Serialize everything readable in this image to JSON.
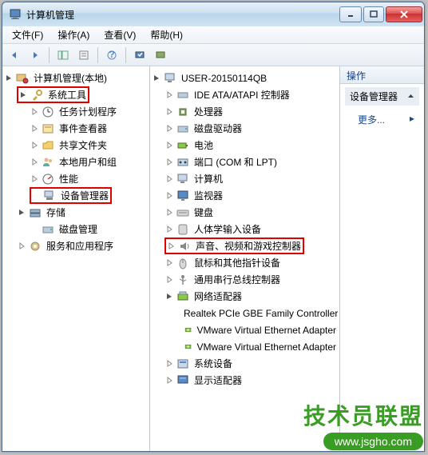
{
  "window": {
    "title": "计算机管理"
  },
  "menubar": [
    {
      "label": "文件(F)"
    },
    {
      "label": "操作(A)"
    },
    {
      "label": "查看(V)"
    },
    {
      "label": "帮助(H)"
    }
  ],
  "left_tree": {
    "root": {
      "label": "计算机管理(本地)"
    },
    "system_tools": {
      "label": "系统工具",
      "children": [
        {
          "label": "任务计划程序"
        },
        {
          "label": "事件查看器"
        },
        {
          "label": "共享文件夹"
        },
        {
          "label": "本地用户和组"
        },
        {
          "label": "性能"
        },
        {
          "label": "设备管理器"
        }
      ]
    },
    "storage": {
      "label": "存储",
      "children": [
        {
          "label": "磁盘管理"
        }
      ]
    },
    "services": {
      "label": "服务和应用程序"
    }
  },
  "mid_tree": {
    "root": {
      "label": "USER-20150114QB"
    },
    "items": [
      {
        "label": "IDE ATA/ATAPI 控制器",
        "expandable": true
      },
      {
        "label": "处理器",
        "expandable": true
      },
      {
        "label": "磁盘驱动器",
        "expandable": true
      },
      {
        "label": "电池",
        "expandable": true
      },
      {
        "label": "端口 (COM 和 LPT)",
        "expandable": true
      },
      {
        "label": "计算机",
        "expandable": true
      },
      {
        "label": "监视器",
        "expandable": true
      },
      {
        "label": "键盘",
        "expandable": true
      },
      {
        "label": "人体学输入设备",
        "expandable": true
      },
      {
        "label": "声音、视频和游戏控制器",
        "expandable": true,
        "highlight": true
      },
      {
        "label": "鼠标和其他指针设备",
        "expandable": true
      },
      {
        "label": "通用串行总线控制器",
        "expandable": true
      },
      {
        "label": "网络适配器",
        "expandable": true,
        "expanded": true,
        "children": [
          {
            "label": "Realtek PCIe GBE Family Controller"
          },
          {
            "label": "VMware Virtual Ethernet Adapter"
          },
          {
            "label": "VMware Virtual Ethernet Adapter"
          }
        ]
      },
      {
        "label": "系统设备",
        "expandable": true
      },
      {
        "label": "显示适配器",
        "expandable": true
      }
    ]
  },
  "actions": {
    "header": "操作",
    "sub": "设备管理器",
    "more": "更多..."
  },
  "watermark": {
    "main": "技术员联盟",
    "url": "www.jsgho.com"
  }
}
